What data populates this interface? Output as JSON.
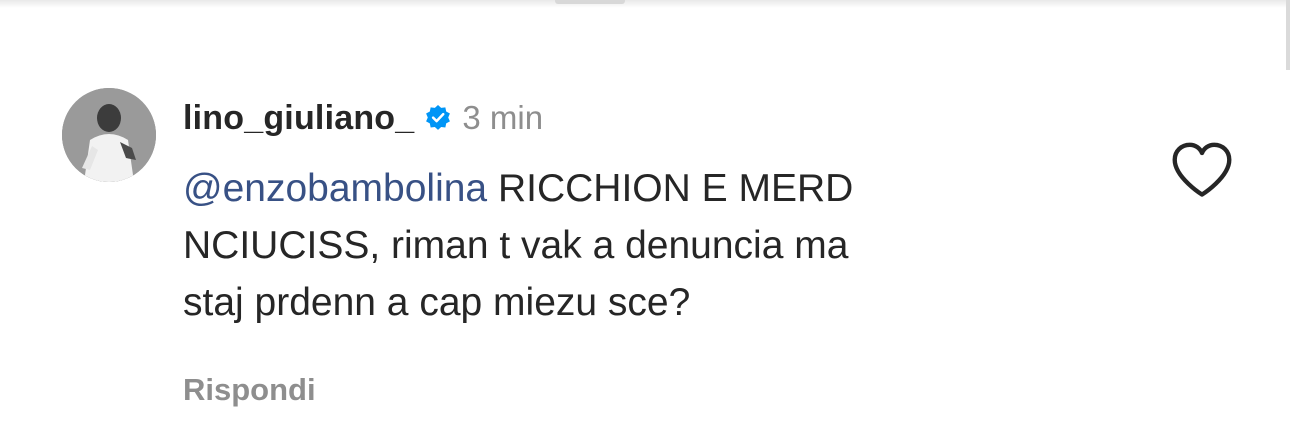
{
  "comment": {
    "username": "lino_giuliano_",
    "verified_icon": "verified-badge-icon",
    "timestamp": "3 min",
    "mention": "@enzobambolina",
    "text_after_mention": " RICCHION E MERD\nNCIUCISS, riman t vak a denuncia ma\nstaj prdenn a cap miezu sce?",
    "reply_label": "Rispondi",
    "like_icon": "heart-outline-icon"
  },
  "colors": {
    "text": "#262626",
    "muted": "#8e8e8e",
    "mention": "#385185",
    "verified": "#0095f6"
  }
}
